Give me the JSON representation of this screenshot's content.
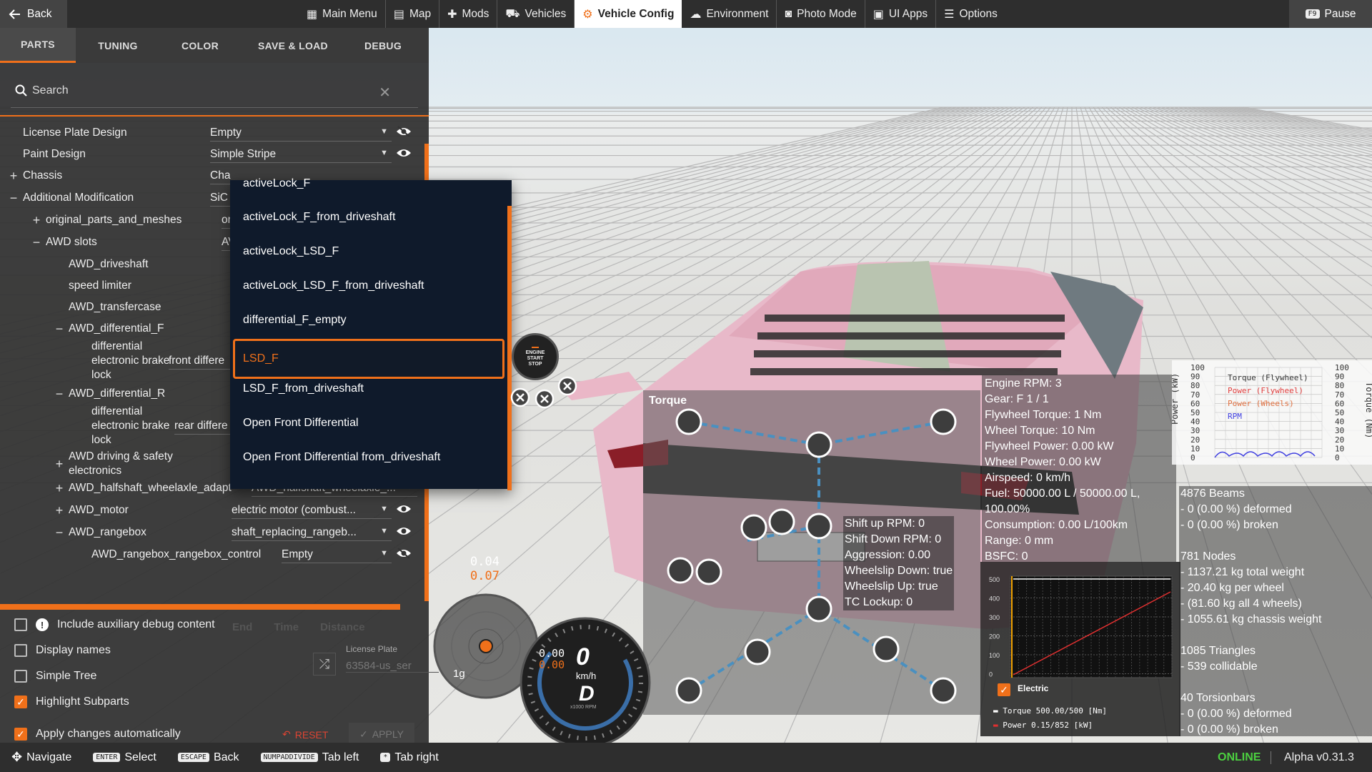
{
  "topbar": {
    "back_label": "Back",
    "tabs": [
      {
        "label": "Main Menu",
        "icon": "grid-icon"
      },
      {
        "label": "Map",
        "icon": "map-icon"
      },
      {
        "label": "Mods",
        "icon": "puzzle-icon"
      },
      {
        "label": "Vehicles",
        "icon": "car-icon"
      },
      {
        "label": "Vehicle Config",
        "icon": "engine-icon",
        "active": true
      },
      {
        "label": "Environment",
        "icon": "weather-icon"
      },
      {
        "label": "Photo Mode",
        "icon": "camera-icon"
      },
      {
        "label": "UI Apps",
        "icon": "apps-icon"
      },
      {
        "label": "Options",
        "icon": "sliders-icon"
      }
    ],
    "pause_key": "F9",
    "pause_label": "Pause"
  },
  "subtabs": [
    "PARTS",
    "TUNING",
    "COLOR",
    "SAVE & LOAD",
    "DEBUG"
  ],
  "search": {
    "placeholder": "Search"
  },
  "tree": [
    {
      "label": "License Plate Design",
      "value": "Empty",
      "eye": "hidden"
    },
    {
      "label": "Paint Design",
      "value": "Simple Stripe",
      "eye": "visible"
    },
    {
      "label": "Chassis",
      "value": "Cha",
      "sign": "+"
    },
    {
      "label": "Additional Modification",
      "value": "SiC",
      "sign": "−"
    },
    {
      "label": "original_parts_and_meshes",
      "value": "or",
      "sign": "+"
    },
    {
      "label": "AWD slots",
      "value": "AV",
      "sign": "−"
    },
    {
      "label": "AWD_driveshaft"
    },
    {
      "label": "speed limiter"
    },
    {
      "label": "AWD_transfercase"
    },
    {
      "label": "AWD_differential_F",
      "sign": "−"
    },
    {
      "label": "differential electronic brake lock",
      "value": "front differe"
    },
    {
      "label": "AWD_differential_R",
      "sign": "−"
    },
    {
      "label": "differential electronic brake lock",
      "value": "rear differe"
    },
    {
      "label": "AWD driving & safety electronics",
      "sign": "+"
    },
    {
      "label": "AWD_halfshaft_wheelaxle_adapt",
      "value": "AWD_halfshaft_wheelaxle_...",
      "sign": "+"
    },
    {
      "label": "AWD_motor",
      "value": "electric motor (combust...",
      "sign": "+",
      "eye": "visible"
    },
    {
      "label": "AWD_rangebox",
      "value": "shaft_replacing_rangeb...",
      "sign": "−",
      "eye": "visible"
    },
    {
      "label": "AWD_rangebox_rangebox_control",
      "value": "Empty",
      "eye": "hidden"
    }
  ],
  "dropdown": {
    "items": [
      "activeLock_F",
      "activeLock_F_from_driveshaft",
      "activeLock_LSD_F",
      "activeLock_LSD_F_from_driveshaft",
      "differential_F_empty",
      "LSD_F",
      "LSD_F_from_driveshaft",
      "Open Front Differential",
      "Open Front Differential from_driveshaft"
    ],
    "selected": "LSD_F"
  },
  "options": [
    {
      "label": "Include auxiliary debug content",
      "checked": false,
      "info": "!"
    },
    {
      "label": "Display names",
      "checked": false
    },
    {
      "label": "Simple Tree",
      "checked": false
    },
    {
      "label": "Highlight Subparts",
      "checked": true
    },
    {
      "label": "Apply changes automatically",
      "checked": true
    }
  ],
  "ghost_columns": [
    "End",
    "Time",
    "Distance"
  ],
  "license_plate": {
    "label": "License Plate",
    "value": "63584-us_ser"
  },
  "buttons": {
    "reset": "RESET",
    "apply": "APPLY"
  },
  "engine_button": {
    "line1": "ENGINE",
    "line2": "START",
    "line3": "STOP"
  },
  "torque_panel": {
    "title": "Torque"
  },
  "shift_info": [
    "Shift up RPM: 0",
    "Shift Down RPM: 0",
    "Aggression: 0.00",
    "Wheelslip Down: true",
    "Wheelslip Up: true",
    "TC Lockup: 0"
  ],
  "engine_info": [
    "Engine RPM: 3",
    "Gear: F 1 / 1",
    "Flywheel Torque: 1 Nm",
    "Wheel Torque: 10 Nm",
    "Flywheel Power: 0.00 kW",
    "Wheel Power: 0.00 kW",
    "Airspeed: 0 km/h",
    "Fuel: 50000.00 L / 50000.00 L,",
    "100.00%",
    "Consumption: 0.00 L/100km",
    "Range: 0 mm",
    "BSFC: 0"
  ],
  "power_graph": {
    "left_axis_label": "Power (kW)",
    "right_axis_label": "Torque (Nm)",
    "ticks": [
      "100",
      "90",
      "80",
      "70",
      "60",
      "50",
      "40",
      "30",
      "20",
      "10",
      "0"
    ],
    "legend": [
      {
        "name": "Torque (Flywheel)",
        "color": "#333333"
      },
      {
        "name": "Power (Flywheel)",
        "color": "#e04040"
      },
      {
        "name": "Power (Wheels)",
        "color": "#e07040"
      },
      {
        "name": "RPM",
        "color": "#4040e0"
      }
    ]
  },
  "stats": [
    "4876 Beams",
    "- 0 (0.00 %) deformed",
    "- 0 (0.00 %) broken",
    "",
    "781 Nodes",
    "- 1137.21 kg total weight",
    "- 20.40 kg per wheel",
    "- (81.60 kg all 4 wheels)",
    "- 1055.61 kg chassis weight",
    "",
    "1085 Triangles",
    "- 539 collidable",
    "",
    "40 Torsionbars",
    "- 0 (0.00 %) deformed",
    "- 0 (0.00 %) broken"
  ],
  "electric_graph": {
    "label": "Electric",
    "checked": true,
    "y_left": [
      "500",
      "400",
      "300",
      "200",
      "100",
      "0"
    ],
    "legend": [
      {
        "text": "Torque 500.00/500 [Nm]",
        "color": "#ffffff"
      },
      {
        "text": "Power  0.15/852   [kW]",
        "color": "#e03030"
      }
    ]
  },
  "gforce": {
    "top": "0.04",
    "bottom": "0.07",
    "label1": "1g",
    "label2": "g"
  },
  "speedo": {
    "speed": "0",
    "unit": "km/h",
    "gear": "D",
    "small1": "0.00",
    "small2": "0.00",
    "rpm_label": "x1000 RPM"
  },
  "bottombar": {
    "hints": [
      {
        "key": "",
        "label": "Navigate",
        "icon": "dpad-icon"
      },
      {
        "key": "ENTER",
        "label": "Select"
      },
      {
        "key": "ESCAPE",
        "label": "Back"
      },
      {
        "key": "NUMPADDIVIDE",
        "label": "Tab left"
      },
      {
        "key": "*",
        "label": "Tab right"
      }
    ],
    "status": "ONLINE",
    "version": "Alpha v0.31.3"
  }
}
